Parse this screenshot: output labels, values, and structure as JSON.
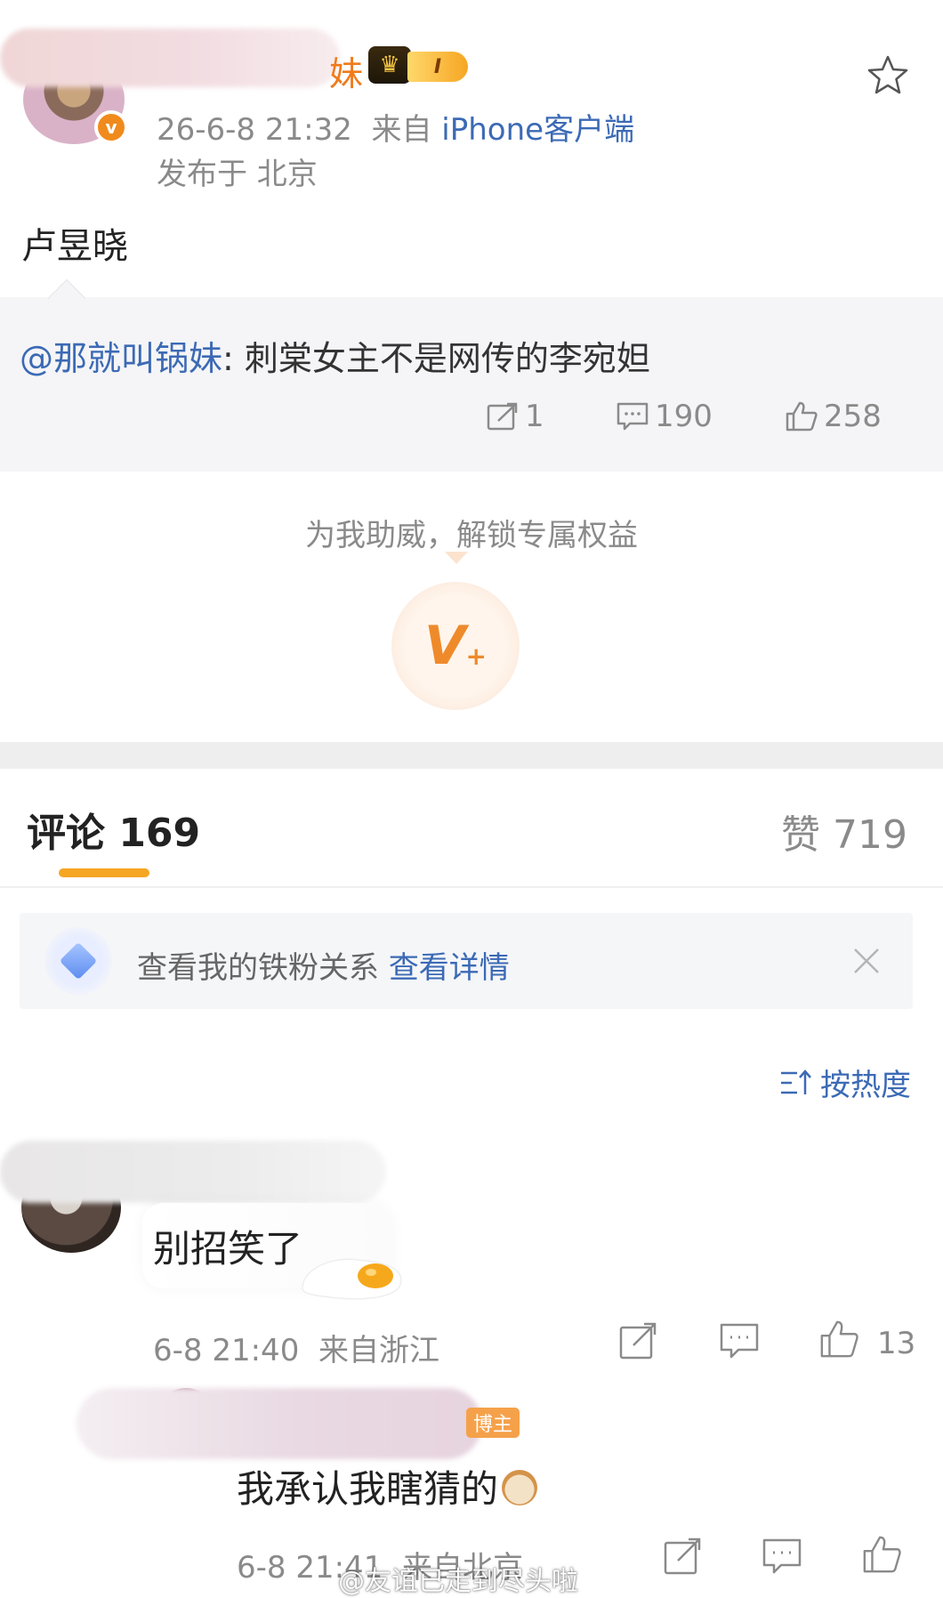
{
  "post": {
    "name_tail": "妹",
    "level": "I",
    "timestamp": "26-6-8 21:32",
    "source_prefix": "来自",
    "source": "iPhone客户端",
    "location": "发布于 北京",
    "text": "卢昱晓"
  },
  "retweet": {
    "mention": "@那就叫锅妹",
    "colon": ":",
    "text": " 刺棠女主不是网传的李宛妲",
    "reposts": "1",
    "comments": "190",
    "likes": "258"
  },
  "boost": {
    "text": "为我助威，解锁专属权益",
    "badge_v": "V",
    "badge_plus": "+"
  },
  "comments_section": {
    "tab_label": "评论 169",
    "likes_label": "赞 719",
    "fan_banner_text": "查看我的铁粉关系",
    "fan_banner_link": "查看详情",
    "sort_label": "按热度",
    "sort_icon": "sort-lines-icon"
  },
  "comments": [
    {
      "text": "别招笑了",
      "time": "6-8 21:40",
      "source": "来自浙江",
      "likes": "13"
    },
    {
      "author_badge": "博主",
      "text": "我承认我瞎猜的",
      "time": "6-8 21:41",
      "source": "来自北京"
    }
  ],
  "watermark": "@友谊已走到尽头啦",
  "colors": {
    "link_blue": "#3c6ab5",
    "accent_orange": "#f5a623",
    "gray_text": "#8a8a8a",
    "verified_orange": "#f08a1c"
  }
}
